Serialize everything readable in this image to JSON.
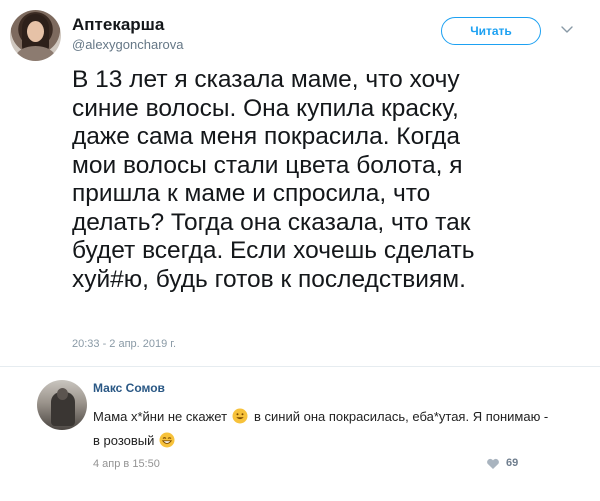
{
  "tweet": {
    "author_name": "Аптекарша",
    "author_handle": "@alexygoncharova",
    "follow_label": "Читать",
    "text": "В 13 лет я сказала маме, что хочу\nсиние волосы. Она купила краску,\nдаже сама меня покрасила. Когда\nмои волосы стали цвета болота, я\nпришла к маме и спросила, что\nделать? Тогда она сказала, что так\nбудет всегда. Если хочешь сделать\nхуй#ю, будь готов к последствиям.",
    "timestamp": "20:33 - 2 апр. 2019 г.",
    "icons": {
      "more": "chevron-down-icon"
    },
    "colors": {
      "accent": "#1da1f2",
      "secondary_text": "#657786"
    }
  },
  "comment": {
    "author_name": "Макс Сомов",
    "text_part1": "Мама х*йни не скажет",
    "text_part2": "в синий она покрасилась, еба*утая. Я понимаю - в розовый",
    "date": "4 апр в 15:50",
    "likes": "69",
    "icons": {
      "emoji": "smiling-face-emoji-icon",
      "like": "heart-icon"
    },
    "colors": {
      "author": "#2a5885",
      "emoji": "#f7c23b"
    }
  }
}
